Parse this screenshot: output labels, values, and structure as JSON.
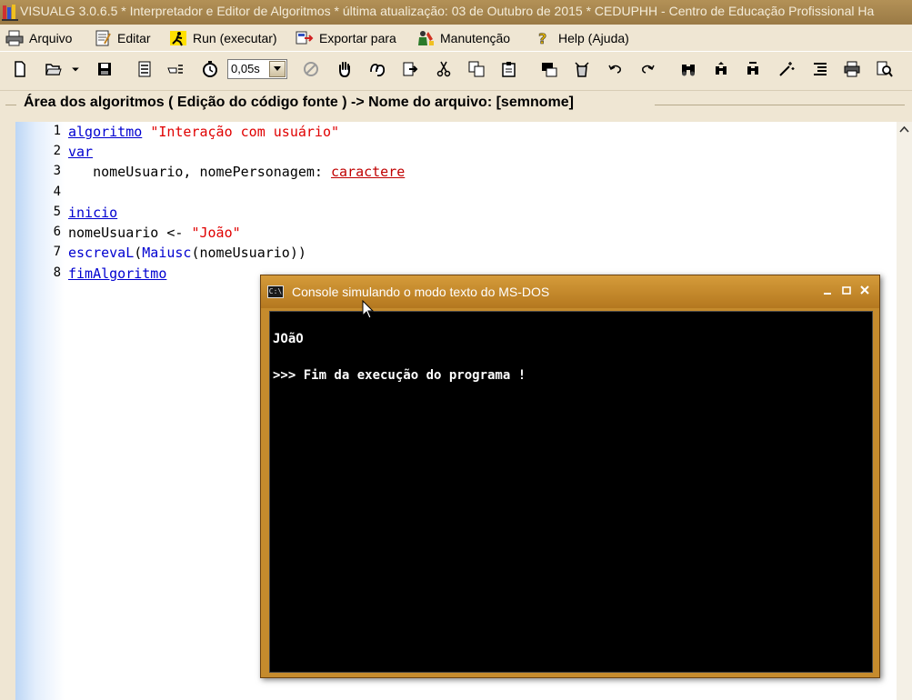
{
  "window": {
    "title": "VISUALG 3.0.6.5 * Interpretador e Editor de Algoritmos * última atualização: 03 de Outubro de 2015 * CEDUPHH - Centro de Educação Profissional Ha"
  },
  "menu": [
    {
      "label": "Arquivo",
      "icon": "printer-icon"
    },
    {
      "label": "Editar",
      "icon": "edit-icon"
    },
    {
      "label": "Run (executar)",
      "icon": "run-icon"
    },
    {
      "label": "Exportar para",
      "icon": "export-icon"
    },
    {
      "label": "Manutenção",
      "icon": "maintenance-icon"
    },
    {
      "label": "Help (Ajuda)",
      "icon": "help-icon"
    }
  ],
  "toolbar": {
    "speed_value": "0,05s"
  },
  "editor": {
    "group_title": "Área dos algoritmos ( Edição do código fonte ) -> Nome do arquivo: [semnome]",
    "line_numbers": [
      "1",
      "2",
      "3",
      "4",
      "5",
      "6",
      "7",
      "8"
    ],
    "lines": [
      [
        {
          "t": "algoritmo",
          "c": "kw"
        },
        {
          "t": " ",
          "c": ""
        },
        {
          "t": "\"Interação com usuário\"",
          "c": "str"
        }
      ],
      [
        {
          "t": "var",
          "c": "kw"
        }
      ],
      [
        {
          "t": "   nomeUsuario, nomePersonagem: ",
          "c": ""
        },
        {
          "t": "caractere",
          "c": "kw2"
        }
      ],
      [],
      [
        {
          "t": "inicio",
          "c": "kw"
        }
      ],
      [
        {
          "t": "nomeUsuario <- ",
          "c": ""
        },
        {
          "t": "\"João\"",
          "c": "str"
        }
      ],
      [
        {
          "t": "escrevaL",
          "c": "fn"
        },
        {
          "t": "(",
          "c": ""
        },
        {
          "t": "Maiusc",
          "c": "fn"
        },
        {
          "t": "(nomeUsuario))",
          "c": ""
        }
      ],
      [
        {
          "t": "fimAlgoritmo",
          "c": "kw"
        }
      ]
    ]
  },
  "console": {
    "title": "Console simulando o modo texto do MS-DOS",
    "icon_text": "C:\\",
    "output": [
      "JOãO",
      "",
      ">>> Fim da execução do programa !"
    ]
  },
  "colors": {
    "keyword": "#0000d0",
    "string": "#e00000",
    "type": "#c00000",
    "console_frame": "#c58b2d"
  }
}
